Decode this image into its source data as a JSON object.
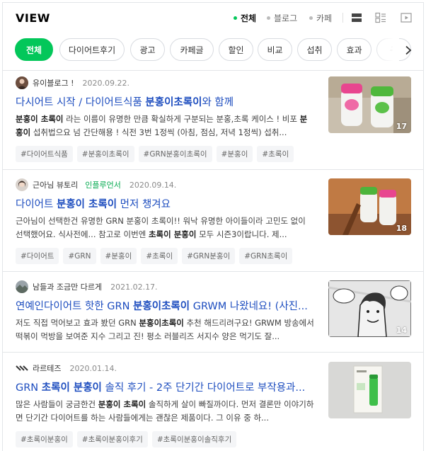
{
  "header": {
    "title": "VIEW",
    "filters": [
      {
        "label": "전체",
        "active": true
      },
      {
        "label": "블로그",
        "active": false
      },
      {
        "label": "카페",
        "active": false
      }
    ],
    "view_icons": [
      "list-view-icon",
      "card-view-icon",
      "video-view-icon"
    ]
  },
  "chips": [
    "전체",
    "다이어트후기",
    "광고",
    "카페글",
    "할인",
    "비교",
    "섭취",
    "효과",
    "구"
  ],
  "accent_color": "#03c75a",
  "link_color": "#1d4dbf",
  "results": [
    {
      "source": "유이블로그 !",
      "badge": "",
      "date": "2020.09.22.",
      "title": [
        {
          "text": "다시어트 시작 / 다이어트식품 ",
          "bold": false
        },
        {
          "text": "분홍이초록이",
          "bold": true
        },
        {
          "text": "와 함께",
          "bold": false
        }
      ],
      "description": [
        {
          "text": "분홍이 초록이",
          "bold": true
        },
        {
          "text": " 라는 이름이 유명한 만큼 확실하게 구분되는 분홍,초록 케이스 ! 비포 ",
          "bold": false
        },
        {
          "text": "분홍이",
          "bold": true
        },
        {
          "text": " 섭취법으요 넘 간단해용 ! 식전 3번 1정씩 (아침, 점심, 저녁 1정씩) 섭취...",
          "bold": false
        }
      ],
      "tags": [
        "#다이어트식품",
        "#분홍이초록이",
        "#GRN분홍이초록이",
        "#분홍이",
        "#초록이"
      ],
      "thumb_count": "17"
    },
    {
      "source": "근아님 뷰토리",
      "badge": "인플루언서",
      "date": "2020.09.14.",
      "title": [
        {
          "text": "다이어트 ",
          "bold": false
        },
        {
          "text": "분홍이 초록이",
          "bold": true
        },
        {
          "text": " 먼저 챙겨요",
          "bold": false
        }
      ],
      "description": [
        {
          "text": "근아님이 선택한건 유명한 GRN 분홍이 초록이!! 워낙 유명한 아이들이라 고민도 없이 선택했어요. 식사전에... 참고로 이번엔 ",
          "bold": false
        },
        {
          "text": "초록이 분홍이",
          "bold": true
        },
        {
          "text": " 모두 시즌3이랍니다. 제...",
          "bold": false
        }
      ],
      "tags": [
        "#다이어트",
        "#GRN",
        "#분홍이",
        "#초록이",
        "#GRN분홍이",
        "#GRN초록이"
      ],
      "thumb_count": "18"
    },
    {
      "source": "남들과 조금만 다르게",
      "badge": "",
      "date": "2021.02.17.",
      "title": [
        {
          "text": "연예인다이어트 핫한 GRN ",
          "bold": false
        },
        {
          "text": "분홍이초록이",
          "bold": true
        },
        {
          "text": " GRWM 나왔네요! (사진...",
          "bold": false
        }
      ],
      "description": [
        {
          "text": "저도 직접 먹어보고 효과 봤던 GRN ",
          "bold": false
        },
        {
          "text": "분홍이초록이",
          "bold": true
        },
        {
          "text": " 추천 해드리려구요! GRWM 방송에서 떡볶이 먹방을 보여준 지수 그리고 진! 평소 러블리즈 서지수 양은 먹기도 잘...",
          "bold": false
        }
      ],
      "tags": [],
      "thumb_count": "14"
    },
    {
      "source": "라르테즈",
      "badge": "",
      "date": "2020.01.14.",
      "title": [
        {
          "text": "GRN ",
          "bold": false
        },
        {
          "text": "초록이 분홍이",
          "bold": true
        },
        {
          "text": " 솔직 후기 - 2주 단기간 다이어트로 부작용과...",
          "bold": false
        }
      ],
      "description": [
        {
          "text": "많은 사람들이 궁금한건 ",
          "bold": false
        },
        {
          "text": "분홍이 초록이",
          "bold": true
        },
        {
          "text": " 솔직하게 살이 빠질까이다. 먼저 결론만 이야기하면 단기간 다이어트를 하는 사람들에게는 괜찮은 제품이다. 그 이유 중 하...",
          "bold": false
        }
      ],
      "tags": [
        "#초록이분홍이",
        "#초록이분홍이후기",
        "#초록이분홍이솔직후기"
      ],
      "thumb_count": ""
    }
  ]
}
